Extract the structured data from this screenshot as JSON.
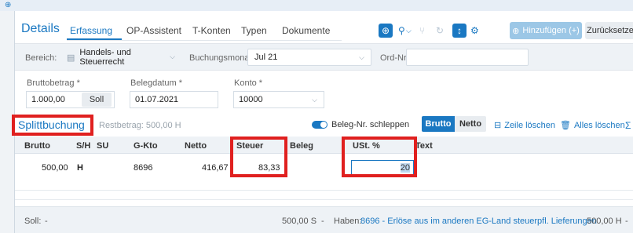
{
  "header": {
    "title": "Details",
    "tabs": [
      {
        "label": "Erfassung"
      },
      {
        "label": "OP-Assistent"
      },
      {
        "label": "T-Konten"
      },
      {
        "label": "Typen"
      },
      {
        "label": "Dokumente"
      }
    ],
    "add_button": "Hinzufügen (+)",
    "back_button": "Zurücksetzen"
  },
  "filter": {
    "bereich_label": "Bereich:",
    "bereich_value": "Handels- und Steuerrecht",
    "monat_label": "Buchungsmonat:",
    "monat_value": "Jul 21",
    "ordnr_label": "Ord-Nr:",
    "ordnr_value": ""
  },
  "form": {
    "brutto_label": "Bruttobetrag *",
    "brutto_value": "1.000,00",
    "soll_button": "Soll",
    "datum_label": "Belegdatum *",
    "datum_value": "01.07.2021",
    "konto_label": "Konto *",
    "konto_value": "10000"
  },
  "split": {
    "title": "Splittbuchung",
    "restbetrag": "Restbetrag: 500,00 H",
    "toggle_label": "Beleg-Nr. schleppen",
    "toggle_on": true,
    "seg_brutto": "Brutto",
    "seg_netto": "Netto",
    "delete_row": "Zeile löschen",
    "delete_all": "Alles löschen",
    "sum_icon": "Σ"
  },
  "table": {
    "columns": [
      "Brutto",
      "S/H",
      "SU",
      "G-Kto",
      "Netto",
      "Steuer",
      "Beleg",
      "USt. %",
      "Text"
    ],
    "rows": [
      {
        "brutto": "500,00",
        "sh": "H",
        "su": "",
        "gkto": "8696",
        "netto": "416,67",
        "steuer": "83,33",
        "beleg": "",
        "ust": "20",
        "text": ""
      }
    ]
  },
  "footer": {
    "soll_label": "Soll:",
    "soll_value": "-",
    "soll_amount": "500,00 S",
    "soll_dash": "-",
    "haben_label": "Haben:",
    "haben_link": "8696 - Erlöse aus im anderen EG-Land steuerpfl. Lieferungen",
    "haben_amount": "500,00 H",
    "haben_dash": "-"
  },
  "colors": {
    "accent": "#1a78c2",
    "highlight": "#e0201f"
  }
}
